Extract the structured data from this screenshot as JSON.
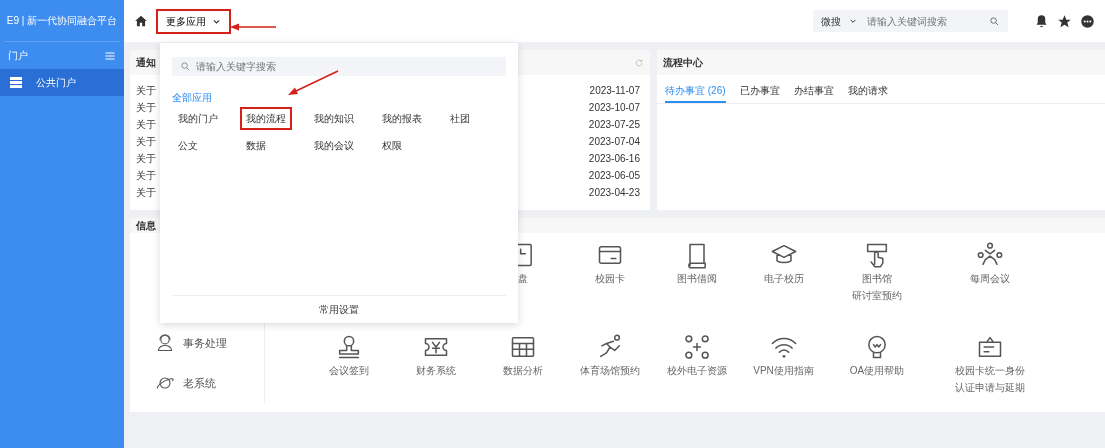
{
  "sidebar": {
    "title": "E9 | 新一代协同融合平台",
    "section": "门户",
    "items": [
      {
        "label": "公共门户",
        "selected": true
      }
    ]
  },
  "topbar": {
    "menu_button": {
      "label": "更多应用",
      "highlighted": true
    },
    "search": {
      "scope": "微搜",
      "placeholder": "请输入关键词搜索"
    }
  },
  "notice_card": {
    "title": "通知",
    "items": [
      {
        "title": "关于",
        "date": "2023-11-07"
      },
      {
        "title": "关于",
        "date": "2023-10-07"
      },
      {
        "title": "关于",
        "date": "2023-07-25"
      },
      {
        "title": "关于",
        "date": "2023-07-04"
      },
      {
        "title": "关于",
        "date": "2023-06-16"
      },
      {
        "title": "关于",
        "date": "2023-06-05"
      },
      {
        "title": "关于",
        "date": "2023-04-23"
      }
    ]
  },
  "flow_card": {
    "title": "流程中心",
    "tabs": [
      {
        "label": "待办事宜 (26)",
        "selected": true
      },
      {
        "label": "已办事宜",
        "selected": false
      },
      {
        "label": "办结事宜",
        "selected": false
      },
      {
        "label": "我的请求",
        "selected": false
      }
    ]
  },
  "info_card": {
    "title": "信息",
    "side_items": [
      "事务处理",
      "老系统"
    ],
    "apps_row_1": [
      [
        "盘"
      ],
      [
        "校园卡"
      ],
      [
        "图书借阅"
      ],
      [
        "电子校历"
      ],
      [
        "图书馆",
        "研讨室预约"
      ],
      [
        "每周会议"
      ]
    ],
    "apps_row_2": [
      [
        "会议签到"
      ],
      [
        "财务系统"
      ],
      [
        "数据分析"
      ],
      [
        "体育场馆预约"
      ],
      [
        "校外电子资源"
      ],
      [
        "VPN使用指南"
      ],
      [
        "OA使用帮助"
      ],
      [
        "校园卡统一身份",
        "认证申请与延期"
      ]
    ]
  },
  "dropdown": {
    "placeholder": "请输入关键字搜索",
    "group": "全部应用",
    "apps": [
      {
        "label": "我的门户",
        "highlighted": false
      },
      {
        "label": "我的流程",
        "highlighted": true
      },
      {
        "label": "我的知识",
        "highlighted": false
      },
      {
        "label": "我的报表",
        "highlighted": false
      },
      {
        "label": "社团",
        "highlighted": false
      },
      {
        "label": "公文",
        "highlighted": false
      },
      {
        "label": "数据",
        "highlighted": false
      },
      {
        "label": "我的会议",
        "highlighted": false
      },
      {
        "label": "权限",
        "highlighted": false
      }
    ],
    "footer": "常用设置"
  }
}
